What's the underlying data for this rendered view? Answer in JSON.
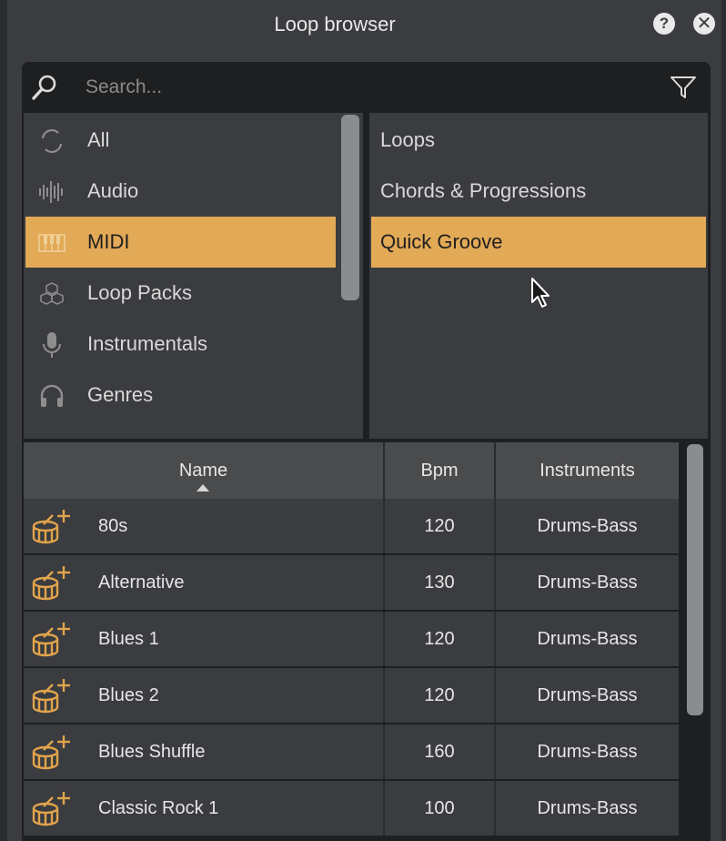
{
  "window": {
    "title": "Loop browser",
    "help_label": "?",
    "close_label": "✕"
  },
  "search": {
    "placeholder": "Search...",
    "value": ""
  },
  "categories": [
    {
      "label": "All",
      "icon": "refresh-icon"
    },
    {
      "label": "Audio",
      "icon": "waveform-icon"
    },
    {
      "label": "MIDI",
      "icon": "keyboard-icon",
      "selected": true
    },
    {
      "label": "Loop Packs",
      "icon": "cubes-icon"
    },
    {
      "label": "Instrumentals",
      "icon": "microphone-icon"
    },
    {
      "label": "Genres",
      "icon": "headphones-icon"
    }
  ],
  "subcategories": [
    {
      "label": "Loops"
    },
    {
      "label": "Chords & Progressions"
    },
    {
      "label": "Quick Groove",
      "selected": true
    }
  ],
  "table": {
    "headers": {
      "name": "Name",
      "bpm": "Bpm",
      "instruments": "Instruments"
    },
    "sort_column": "Name",
    "sort_direction": "ascending",
    "rows": [
      {
        "name": "80s",
        "bpm": "120",
        "instruments": "Drums-Bass"
      },
      {
        "name": "Alternative",
        "bpm": "130",
        "instruments": "Drums-Bass"
      },
      {
        "name": "Blues 1",
        "bpm": "120",
        "instruments": "Drums-Bass"
      },
      {
        "name": "Blues 2",
        "bpm": "120",
        "instruments": "Drums-Bass"
      },
      {
        "name": "Blues Shuffle",
        "bpm": "160",
        "instruments": "Drums-Bass"
      },
      {
        "name": "Classic Rock 1",
        "bpm": "100",
        "instruments": "Drums-Bass"
      }
    ]
  },
  "colors": {
    "accent": "#e2a957",
    "panel_bg": "#3a3c3f",
    "dark_bg": "#1e1f21",
    "header_bg": "#4a4b4d",
    "drum_icon": "#e2a44c"
  }
}
